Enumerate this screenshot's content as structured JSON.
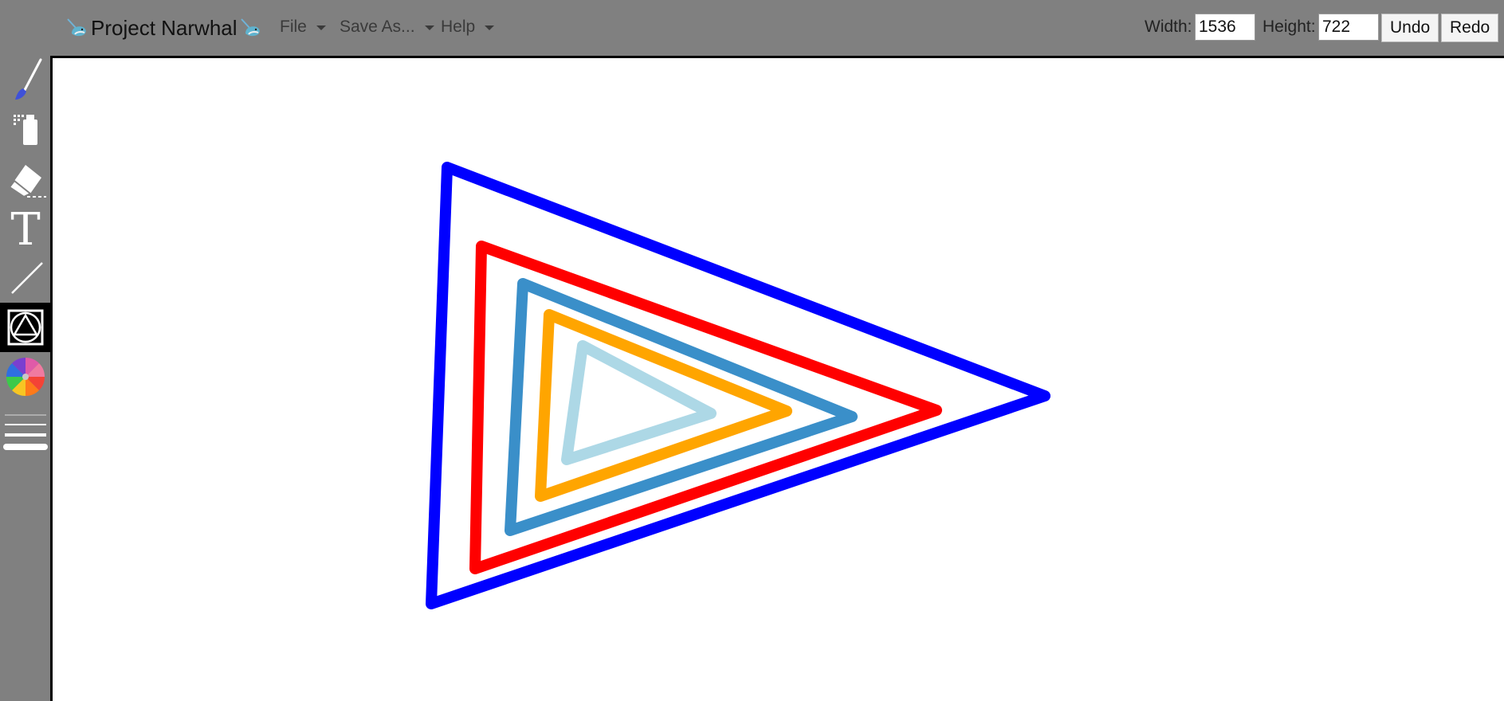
{
  "app": {
    "title": "Project Narwhal"
  },
  "menus": [
    {
      "label": "File"
    },
    {
      "label": "Save As..."
    },
    {
      "label": "Help"
    }
  ],
  "dimensions": {
    "width_label": "Width:",
    "width_value": "1536",
    "height_label": "Height:",
    "height_value": "722"
  },
  "toolbar": {
    "undo_label": "Undo",
    "redo_label": "Redo"
  },
  "tools": [
    {
      "name": "brush-icon",
      "active": false
    },
    {
      "name": "spray-icon",
      "active": false
    },
    {
      "name": "eraser-icon",
      "active": false
    },
    {
      "name": "text-icon",
      "active": false
    },
    {
      "name": "line-icon",
      "active": false
    },
    {
      "name": "shapes-icon",
      "active": true
    },
    {
      "name": "color-wheel-icon",
      "active": false
    },
    {
      "name": "stroke-width-icon",
      "active": false
    }
  ],
  "canvas": {
    "shapes": [
      {
        "type": "triangle",
        "color": "#0000ff"
      },
      {
        "type": "triangle",
        "color": "#ff0000"
      },
      {
        "type": "triangle",
        "color": "#3a8fc9"
      },
      {
        "type": "triangle",
        "color": "#ffa500"
      },
      {
        "type": "triangle",
        "color": "#add8e6"
      }
    ]
  }
}
